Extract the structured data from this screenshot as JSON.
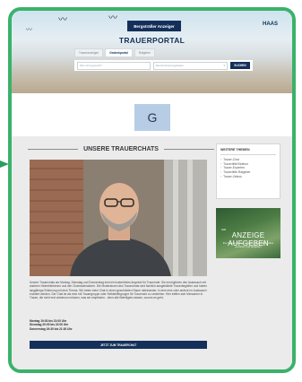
{
  "header": {
    "logo_text": "Bergsträßer Anzeiger",
    "partner_logo": "HAAS",
    "portal_title": "TRAUERPORTAL"
  },
  "tabs": [
    {
      "label": "Traueranzeigen",
      "active": false
    },
    {
      "label": "Gedenkportal",
      "active": true
    },
    {
      "label": "Ratgeber",
      "active": false
    }
  ],
  "search": {
    "name_placeholder": "Wer wird gesucht?",
    "date_placeholder": "Alle Erscheinungsdaten",
    "button_label": "SUCHEN"
  },
  "ad_banner": {
    "letter": "G"
  },
  "section_heading": "UNSERE TRAUERCHATS",
  "body_text": "Unsere Trauerchats am Montag, Dienstag und Donnerstag sind ein kostenfreies Angebot für Trauernde. Sie ermöglichen den Austausch mit anderen Hinterbliebenen und den Chatmoderatoren. Die Moderatoren des Trauerchats sind fachlich ausgebildete Trauerbegleiter und haben langjährige Erfahrung mit dem Thema. Wir treten beim Chat in einen geschützten Raum miteinander, in dem eine oder andere im Austausch erwidert werden. Der Chat ist als eine mit Trauergruppe oder Selbsthilfegruppe für Trauernde zu verstehen. Hier treffen sich Menschen in Trauer, die nicht erst wiederum müssen, was sie empfinden - denn alle Beteiligten wissen, worum es geht.",
  "times": [
    "Montag 19:30 bis 21:00 Uhr",
    "Dienstag 20:00 bis 22:00 Uhr",
    "Donnerstag 19:30 bis 21:30 Uhr"
  ],
  "cta_label": "JETZT ZUM TRAUERCHAT",
  "sidebar": {
    "title": "WEITERE THEMEN",
    "items": [
      "Trauer-Chat",
      "Trauerhilfe/Seelsor",
      "Trauer-Experten",
      "Trauerhilfe-Ratgeber",
      "Trauer-Videos"
    ]
  },
  "side_ad": {
    "small_label": "IHR",
    "headline": "ANZEIGE AUFGEBEN",
    "description": "Ihre Traueranzeige schnell und einfach online gestalten und aufgeben"
  },
  "colors": {
    "frame": "#3ab26a",
    "navy": "#14305a",
    "section_bg": "#ebebeb"
  }
}
